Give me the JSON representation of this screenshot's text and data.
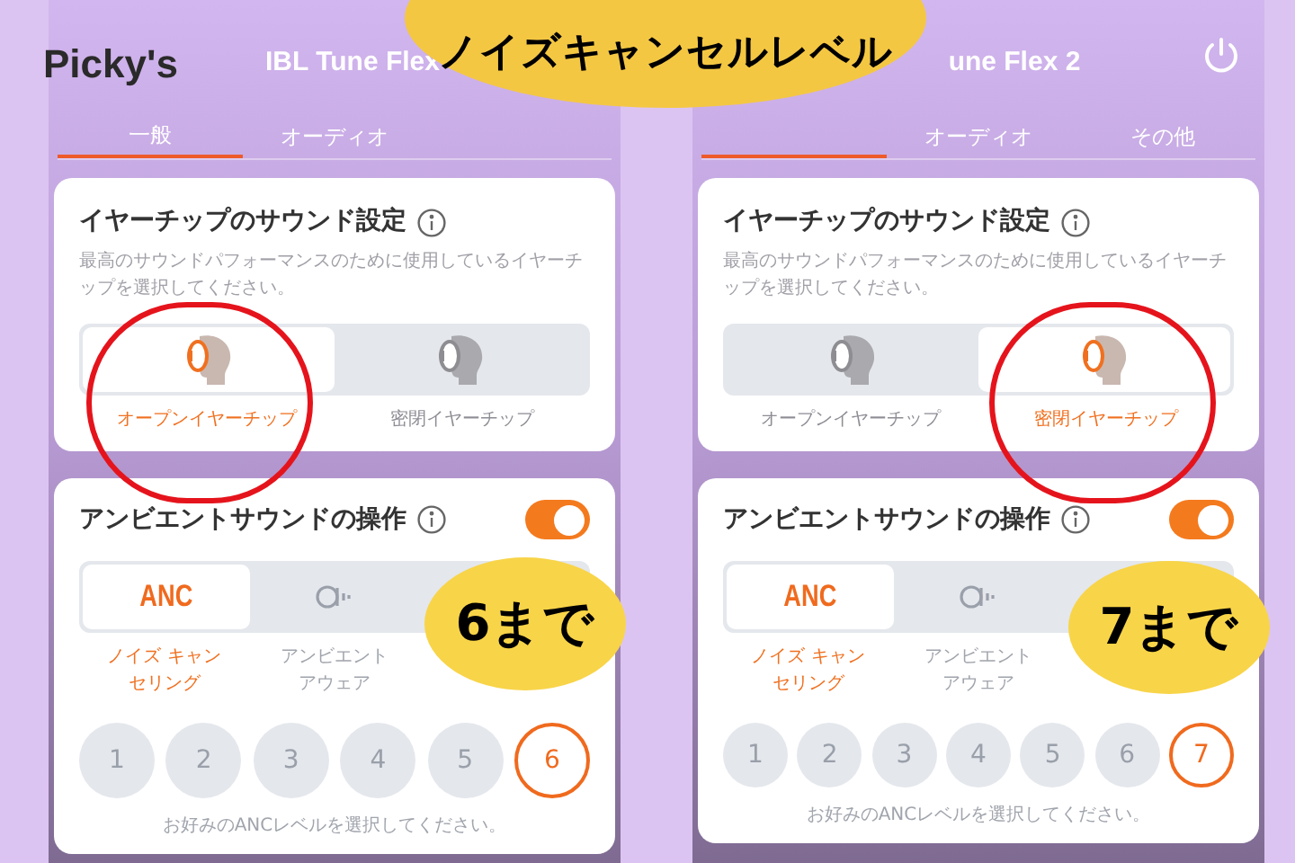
{
  "logo": "Picky's",
  "headline": "ノイズキャンセルレベル",
  "screens": [
    {
      "title": "IBL Tune Flex",
      "power_icon": false,
      "tabs": [
        {
          "label": "一般",
          "selected": true
        },
        {
          "label": "オーディオ",
          "selected": false
        }
      ],
      "eartip": {
        "title": "イヤーチップのサウンド設定",
        "description": "最高のサウンドパフォーマンスのために使用しているイヤーチップを選択してください。",
        "options": [
          {
            "label": "オープンイヤーチップ",
            "selected": true
          },
          {
            "label": "密閉イヤーチップ",
            "selected": false
          }
        ]
      },
      "ambient": {
        "title": "アンビエントサウンドの操作",
        "on": true,
        "modes": [
          {
            "kind": "anc",
            "text": "ANC",
            "lines": [
              "ノイズ キャン",
              "セリング"
            ],
            "selected": true
          },
          {
            "kind": "ambient",
            "lines": [
              "アンビエント",
              "アウェア"
            ],
            "selected": false
          }
        ],
        "levels": [
          {
            "label": "1",
            "selected": false
          },
          {
            "label": "2",
            "selected": false
          },
          {
            "label": "3",
            "selected": false
          },
          {
            "label": "4",
            "selected": false
          },
          {
            "label": "5",
            "selected": false
          },
          {
            "label": "6",
            "selected": true
          }
        ],
        "hint": "お好みのANCレベルを選択してください。"
      },
      "callout": "6まで"
    },
    {
      "title": "une Flex 2",
      "power_icon": true,
      "tabs": [
        {
          "selected": true
        },
        {
          "label": "オーディオ",
          "selected": false
        },
        {
          "label": "その他",
          "selected": false
        }
      ],
      "eartip": {
        "title": "イヤーチップのサウンド設定",
        "description": "最高のサウンドパフォーマンスのために使用しているイヤーチップを選択してください。",
        "options": [
          {
            "label": "オープンイヤーチップ",
            "selected": false
          },
          {
            "label": "密閉イヤーチップ",
            "selected": true
          }
        ]
      },
      "ambient": {
        "title": "アンビエントサウンドの操作",
        "on": true,
        "modes": [
          {
            "kind": "anc",
            "text": "ANC",
            "lines": [
              "ノイズ キャン",
              "セリング"
            ],
            "selected": true
          },
          {
            "kind": "ambient",
            "lines": [
              "アンビエント",
              "アウェア"
            ],
            "selected": false
          }
        ],
        "levels": [
          {
            "label": "1",
            "selected": false
          },
          {
            "label": "2",
            "selected": false
          },
          {
            "label": "3",
            "selected": false
          },
          {
            "label": "4",
            "selected": false
          },
          {
            "label": "5",
            "selected": false
          },
          {
            "label": "6",
            "selected": false
          },
          {
            "label": "7",
            "selected": true
          }
        ],
        "hint": "お好みのANCレベルを選択してください。"
      },
      "callout": "7まで"
    }
  ]
}
